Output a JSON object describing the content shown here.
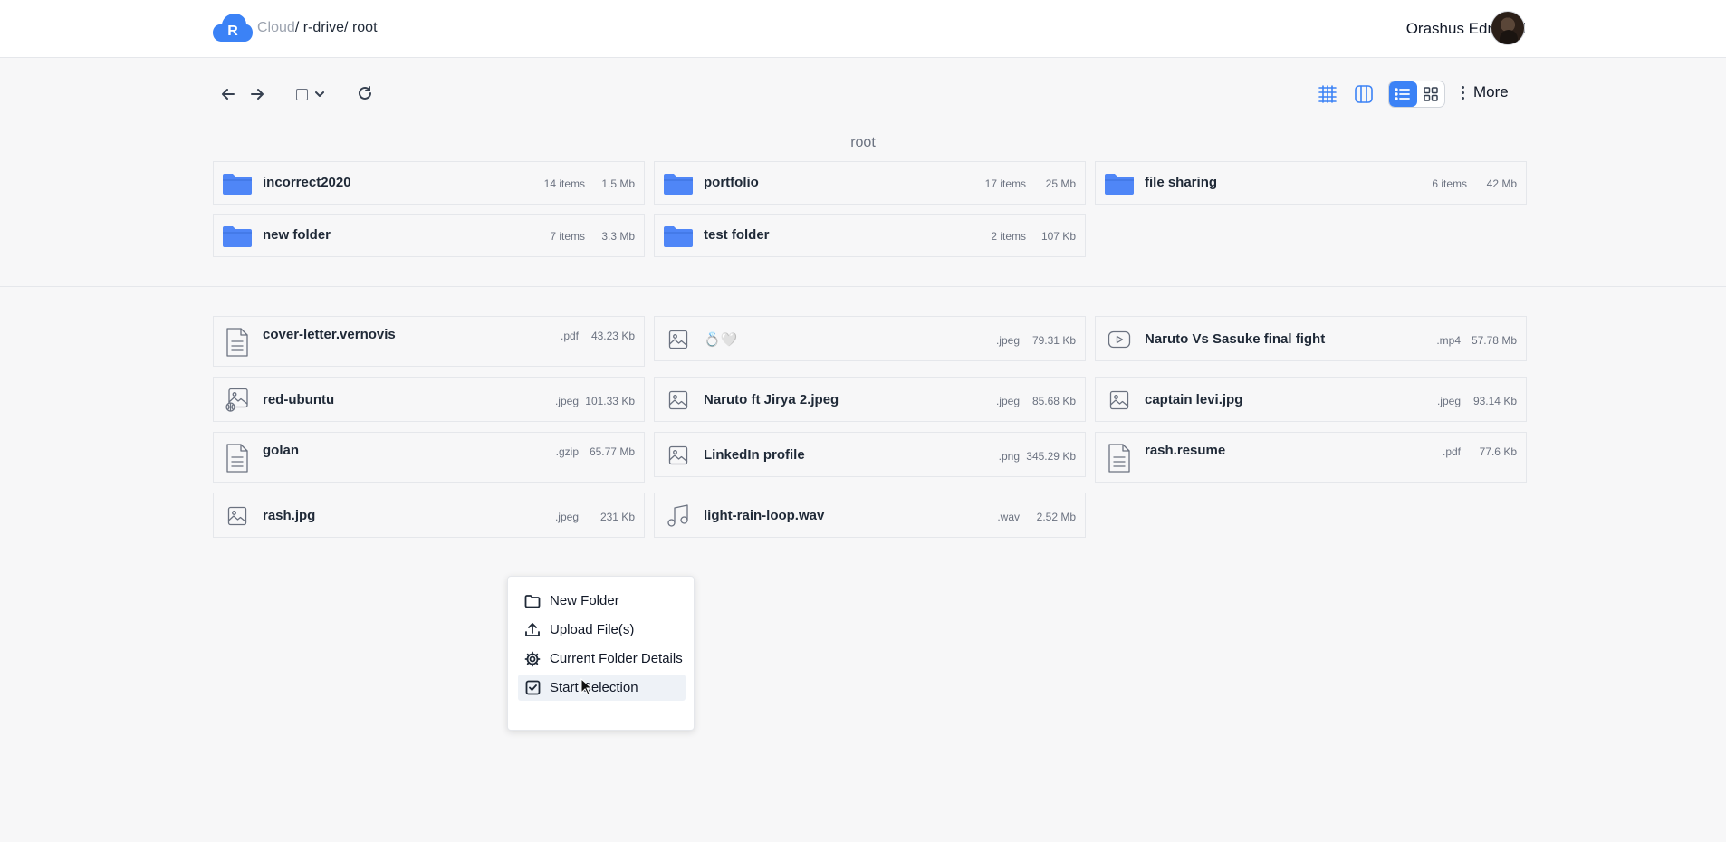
{
  "header": {
    "brand_letter": "R",
    "breadcrumb": [
      "Cloud",
      "/ r-drive",
      "/ root"
    ],
    "user_name": "Orashus Edmund"
  },
  "toolbar": {
    "more_label": "More"
  },
  "section": {
    "title": "root"
  },
  "folders": [
    {
      "name": "incorrect2020",
      "items": "14 items",
      "size": "1.5 Mb"
    },
    {
      "name": "portfolio",
      "items": "17 items",
      "size": "25 Mb"
    },
    {
      "name": "file sharing",
      "items": "6 items",
      "size": "42 Mb"
    },
    {
      "name": "new folder",
      "items": "7 items",
      "size": "3.3 Mb"
    },
    {
      "name": "test folder",
      "items": "2 items",
      "size": "107 Kb"
    }
  ],
  "files": [
    {
      "name": "cover-letter.vernovis",
      "ext": ".pdf",
      "size": "43.23 Kb",
      "icon": "document-icon"
    },
    {
      "name": "💍🤍",
      "ext": ".jpeg",
      "size": "79.31 Kb",
      "icon": "image-icon"
    },
    {
      "name": "Naruto Vs Sasuke final fight",
      "ext": ".mp4",
      "size": "57.78 Mb",
      "icon": "video-icon"
    },
    {
      "name": "red-ubuntu",
      "ext": ".jpeg",
      "size": "101.33 Kb",
      "icon": "image-globe-icon"
    },
    {
      "name": "Naruto ft Jirya 2.jpeg",
      "ext": ".jpeg",
      "size": "85.68 Kb",
      "icon": "image-icon"
    },
    {
      "name": "captain levi.jpg",
      "ext": ".jpeg",
      "size": "93.14 Kb",
      "icon": "image-icon"
    },
    {
      "name": "golan",
      "ext": ".gzip",
      "size": "65.77 Mb",
      "icon": "document-icon"
    },
    {
      "name": "LinkedIn profile",
      "ext": ".png",
      "size": "345.29 Kb",
      "icon": "image-icon"
    },
    {
      "name": "rash.resume",
      "ext": ".pdf",
      "size": "77.6 Kb",
      "icon": "document-icon"
    },
    {
      "name": "rash.jpg",
      "ext": ".jpeg",
      "size": "231 Kb",
      "icon": "image-icon"
    },
    {
      "name": "light-rain-loop.wav",
      "ext": ".wav",
      "size": "2.52 Mb",
      "icon": "music-icon"
    }
  ],
  "context_menu": {
    "items": [
      {
        "label": "New Folder",
        "icon": "folder-outline-icon"
      },
      {
        "label": "Upload File(s)",
        "icon": "upload-icon"
      },
      {
        "label": "Current Folder Details",
        "icon": "gear-icon"
      },
      {
        "label": "Start Selection",
        "icon": "checkbox-icon"
      }
    ]
  },
  "colors": {
    "accent": "#3b82f6",
    "folder": "#4f86f7",
    "background": "#f7f7f8"
  }
}
